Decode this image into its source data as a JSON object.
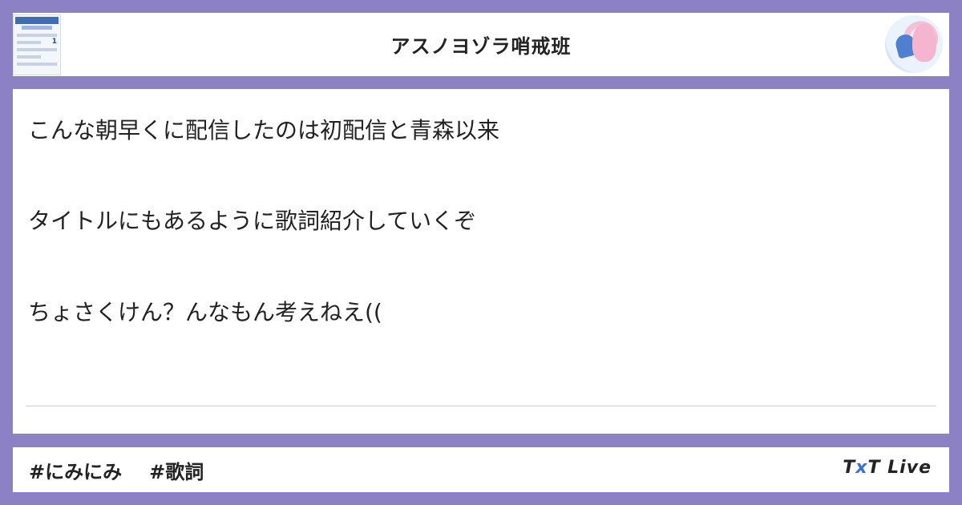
{
  "header": {
    "title": "アスノヨゾラ哨戒班"
  },
  "thumbnail": {
    "rank": "1"
  },
  "post": {
    "lines": [
      "こんな朝早くに配信したのは初配信と青森以来",
      "タイトルにもあるように歌詞紹介していくぞ",
      "ちょさくけん？んなもん考えねえ(("
    ]
  },
  "footer": {
    "tags": [
      "#にみにみ",
      "#歌詞"
    ],
    "brand_left": "T",
    "brand_x": "x",
    "brand_right": "T Live"
  }
}
